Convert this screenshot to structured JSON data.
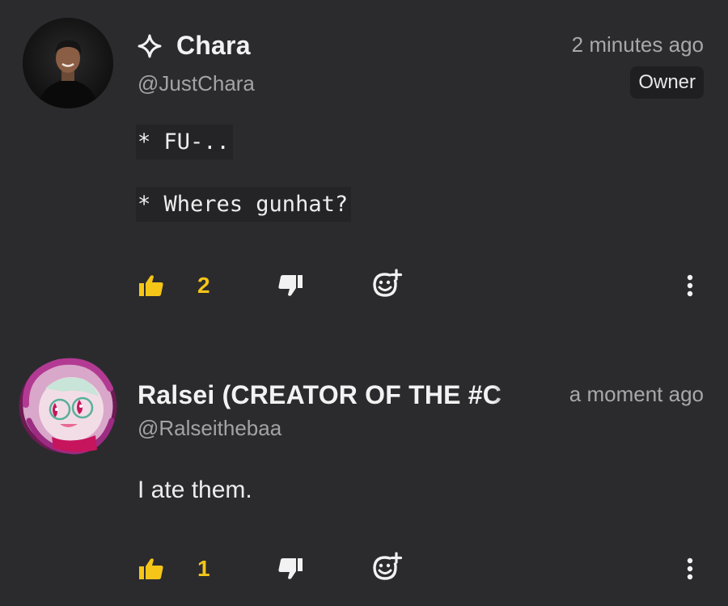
{
  "comments": [
    {
      "display_name": "Chara",
      "handle": "@JustChara",
      "time": "2 minutes ago",
      "badge": "Owner",
      "lines": [
        "* FU-..",
        "* Wheres gunhat?"
      ],
      "likes": "2",
      "icons": {
        "name_prefix": "sparkle-icon",
        "like": "thumbs-up-icon",
        "dislike": "thumbs-down-icon",
        "react": "add-reaction-icon",
        "more": "more-vertical-icon"
      }
    },
    {
      "display_name": "Ralsei (CREATOR OF THE #C",
      "handle": "@Ralseithebaa",
      "time": "a moment ago",
      "text": "I ate them.",
      "likes": "1",
      "icons": {
        "like": "thumbs-up-icon",
        "dislike": "thumbs-down-icon",
        "react": "add-reaction-icon",
        "more": "more-vertical-icon"
      }
    }
  ],
  "colors": {
    "background": "#2b2b2e",
    "accent": "#f5c518",
    "code_bg": "#242426"
  }
}
